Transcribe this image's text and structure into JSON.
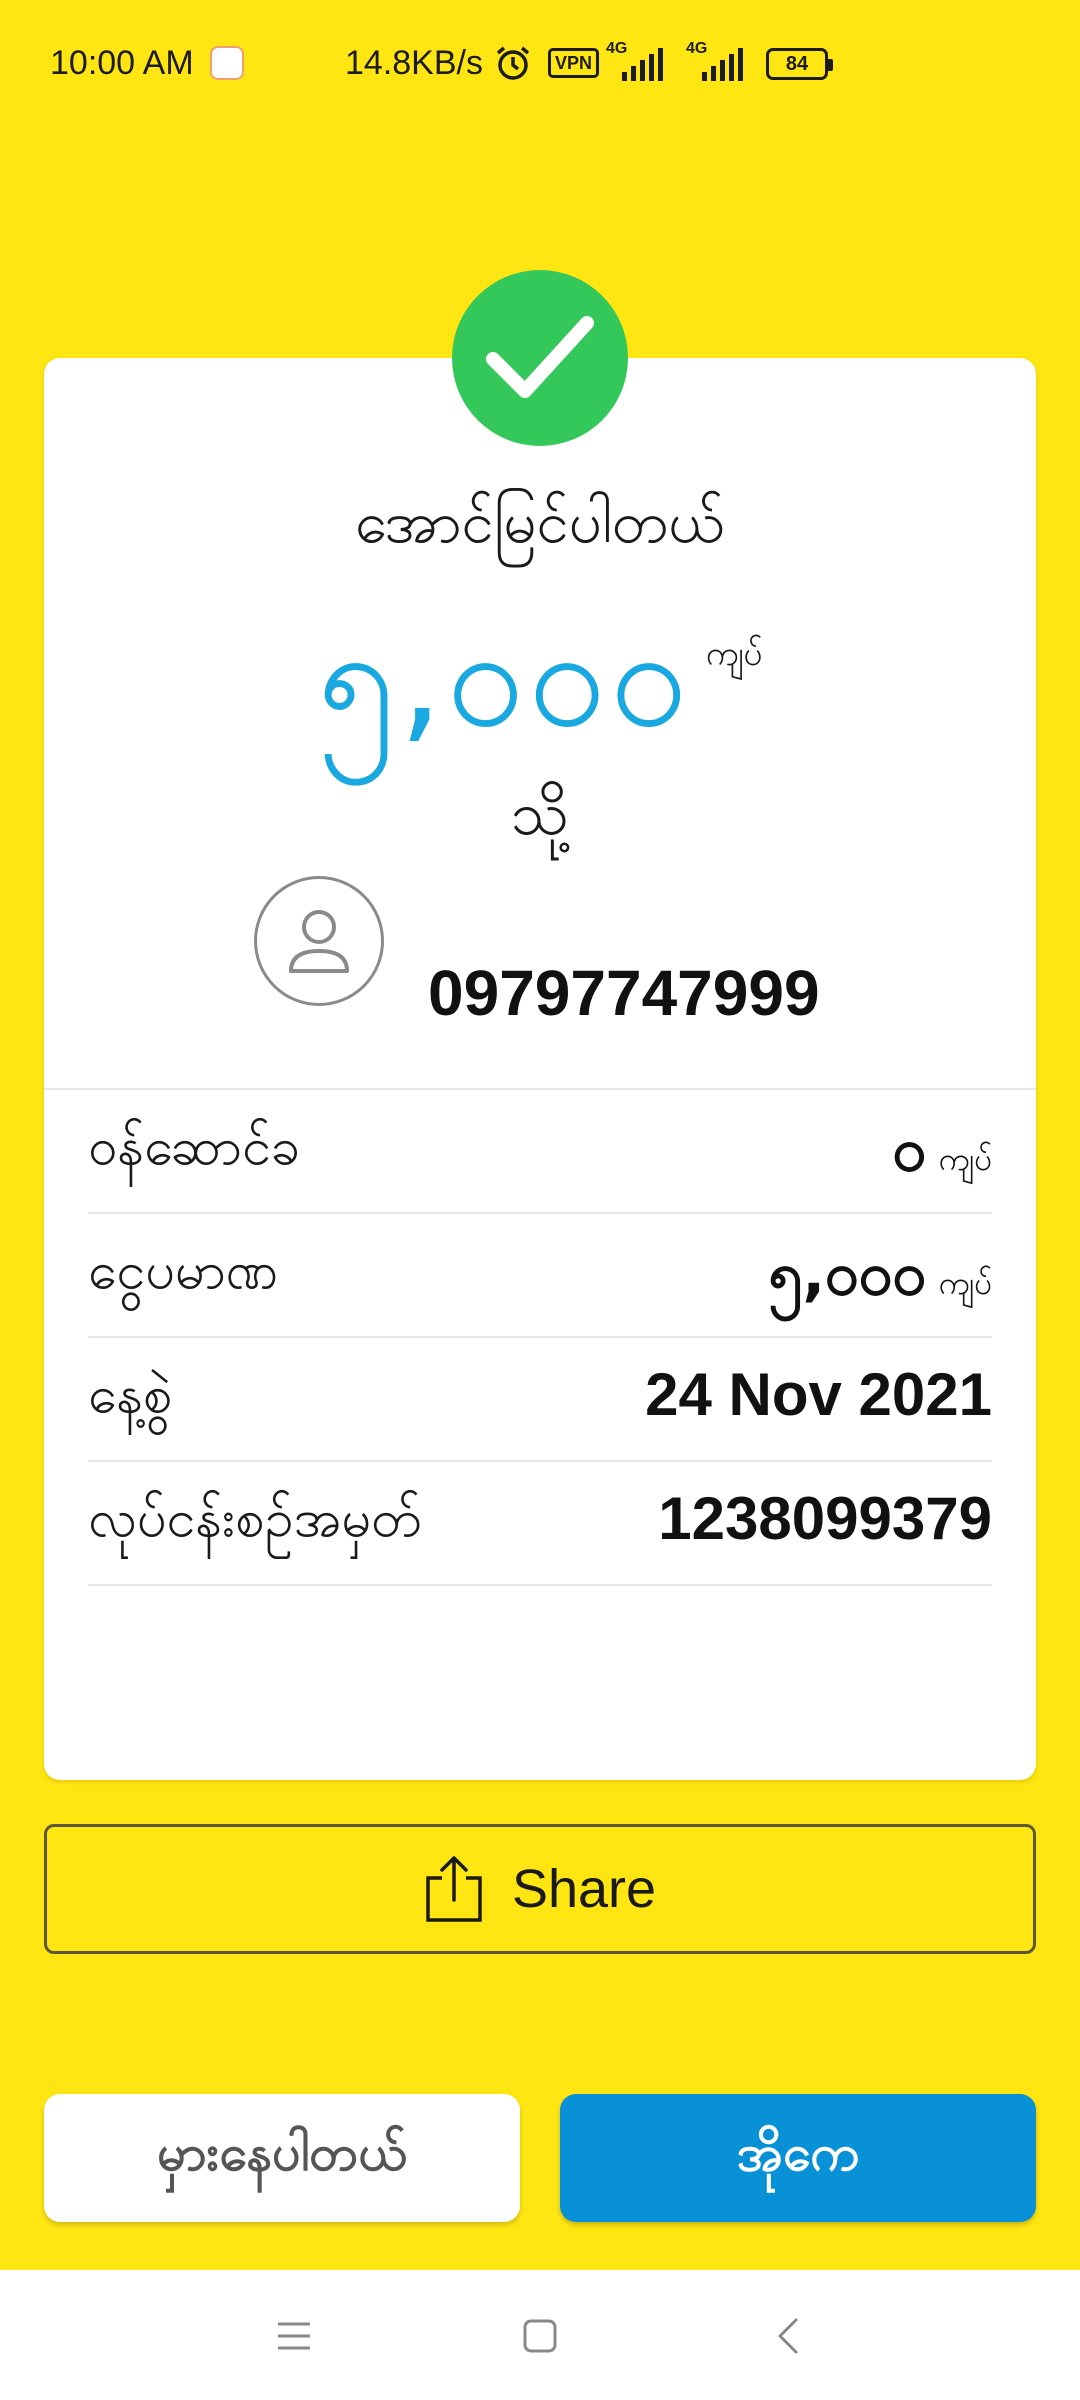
{
  "status_bar": {
    "time": "10:00 AM",
    "net_speed": "14.8KB/s",
    "vpn": "VPN",
    "sim1_network": "4G",
    "sim2_network": "4G",
    "battery": "84"
  },
  "receipt": {
    "title": "အောင်မြင်ပါတယ်",
    "amount": "၅,၀၀၀",
    "amount_unit": "ကျပ်",
    "to_label": "သို့",
    "recipient_phone": "09797747999",
    "details": [
      {
        "label": "ဝန်ဆောင်ခ",
        "value": "၀",
        "unit": "ကျပ်"
      },
      {
        "label": "ငွေပမာဏ",
        "value": "၅,၀၀၀",
        "unit": "ကျပ်"
      },
      {
        "label": "နေ့စွဲ",
        "value": "24 Nov 2021",
        "unit": ""
      },
      {
        "label": "လုပ်ငန်းစဉ်အမှတ်",
        "value": "1238099379",
        "unit": ""
      }
    ]
  },
  "share": {
    "label": "Share"
  },
  "buttons": {
    "error_label": "မှားနေပါတယ်",
    "ok_label": "အိုကေ"
  },
  "colors": {
    "background": "#FFE512",
    "success_green": "#34C759",
    "amount_blue": "#1AA8E0",
    "primary_blue": "#0891D6"
  }
}
